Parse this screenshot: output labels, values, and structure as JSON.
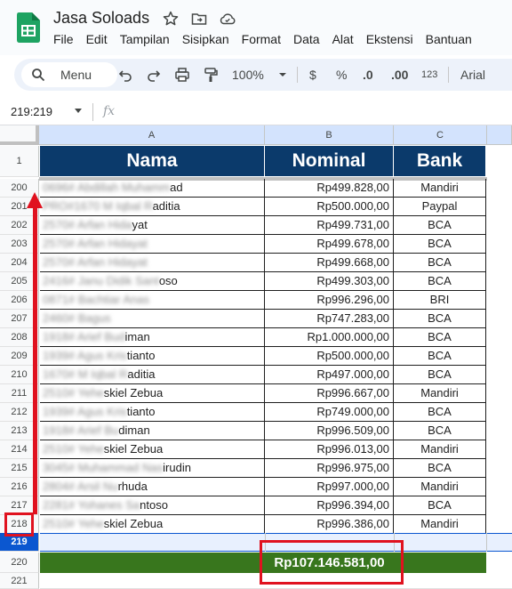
{
  "app": {
    "doc_title": "Jasa Soloads",
    "menus": [
      "File",
      "Edit",
      "Tampilan",
      "Sisipkan",
      "Format",
      "Data",
      "Alat",
      "Ekstensi",
      "Bantuan"
    ]
  },
  "toolbar": {
    "search_label": "Menu",
    "zoom": "100%",
    "currency": "$",
    "percent": "%",
    "decrease_decimal": ".0",
    "increase_decimal": ".00",
    "number_format": "123",
    "font": "Arial"
  },
  "formula_bar": {
    "name_box": "219:219",
    "fx": "fx"
  },
  "columns": [
    "A",
    "B",
    "C"
  ],
  "header_row": {
    "row_number": "1",
    "cells": [
      "Nama",
      "Nominal",
      "Bank"
    ]
  },
  "rows": [
    {
      "num": "200",
      "name_hidden": "0696# Abdillah Muhamm",
      "name_shown": "ad",
      "nominal": "Rp499.828,00",
      "bank": "Mandiri"
    },
    {
      "num": "201",
      "name_hidden": "PRO#1670 M Iqbal R",
      "name_shown": "aditia",
      "nominal": "Rp500.000,00",
      "bank": "Paypal"
    },
    {
      "num": "202",
      "name_hidden": "2570# Arfan Hida",
      "name_shown": "yat",
      "nominal": "Rp499.731,00",
      "bank": "BCA"
    },
    {
      "num": "203",
      "name_hidden": "2570# Arfan Hidayat",
      "name_shown": "",
      "nominal": "Rp499.678,00",
      "bank": "BCA"
    },
    {
      "num": "204",
      "name_hidden": "2570# Arfan Hidayat",
      "name_shown": "",
      "nominal": "Rp499.668,00",
      "bank": "BCA"
    },
    {
      "num": "205",
      "name_hidden": "2416# Janu Didik Sant",
      "name_shown": "oso",
      "nominal": "Rp499.303,00",
      "bank": "BCA"
    },
    {
      "num": "206",
      "name_hidden": "0871# Bachtiar Anas",
      "name_shown": "",
      "nominal": "Rp996.296,00",
      "bank": "BRI"
    },
    {
      "num": "207",
      "name_hidden": "2460# Bagus",
      "name_shown": "",
      "nominal": "Rp747.283,00",
      "bank": "BCA"
    },
    {
      "num": "208",
      "name_hidden": "1918# Arief Bud",
      "name_shown": "iman",
      "nominal": "Rp1.000.000,00",
      "bank": "BCA"
    },
    {
      "num": "209",
      "name_hidden": "1939# Agus Kris",
      "name_shown": "tianto",
      "nominal": "Rp500.000,00",
      "bank": "BCA"
    },
    {
      "num": "210",
      "name_hidden": "1670# M Iqbal R",
      "name_shown": "aditia",
      "nominal": "Rp497.000,00",
      "bank": "BCA"
    },
    {
      "num": "211",
      "name_hidden": "2510# Yehe",
      "name_shown": "skiel Zebua",
      "nominal": "Rp996.667,00",
      "bank": "Mandiri"
    },
    {
      "num": "212",
      "name_hidden": "1939# Agus Kris",
      "name_shown": "tianto",
      "nominal": "Rp749.000,00",
      "bank": "BCA"
    },
    {
      "num": "213",
      "name_hidden": "1918# Arief Bu",
      "name_shown": "diman",
      "nominal": "Rp996.509,00",
      "bank": "BCA"
    },
    {
      "num": "214",
      "name_hidden": "2510# Yehe",
      "name_shown": "skiel Zebua",
      "nominal": "Rp996.013,00",
      "bank": "Mandiri"
    },
    {
      "num": "215",
      "name_hidden": "3045# Muhammad Nas",
      "name_shown": "irudin",
      "nominal": "Rp996.975,00",
      "bank": "BCA"
    },
    {
      "num": "216",
      "name_hidden": "2804# Arsil Nu",
      "name_shown": "rhuda",
      "nominal": "Rp997.000,00",
      "bank": "Mandiri"
    },
    {
      "num": "217",
      "name_hidden": "2281# Yohanes Sa",
      "name_shown": "ntoso",
      "nominal": "Rp996.394,00",
      "bank": "BCA"
    },
    {
      "num": "218",
      "name_hidden": "2510# Yehe",
      "name_shown": "skiel Zebua",
      "nominal": "Rp996.386,00",
      "bank": "Mandiri"
    }
  ],
  "selected_row_num": "219",
  "total_row": {
    "num": "220",
    "total": "Rp107.146.581,00"
  },
  "last_row_num": "221",
  "colors": {
    "header_fill": "#0b3a6b",
    "total_fill": "#38761d",
    "annotation": "#e0121f",
    "selection": "#0b57d0"
  }
}
